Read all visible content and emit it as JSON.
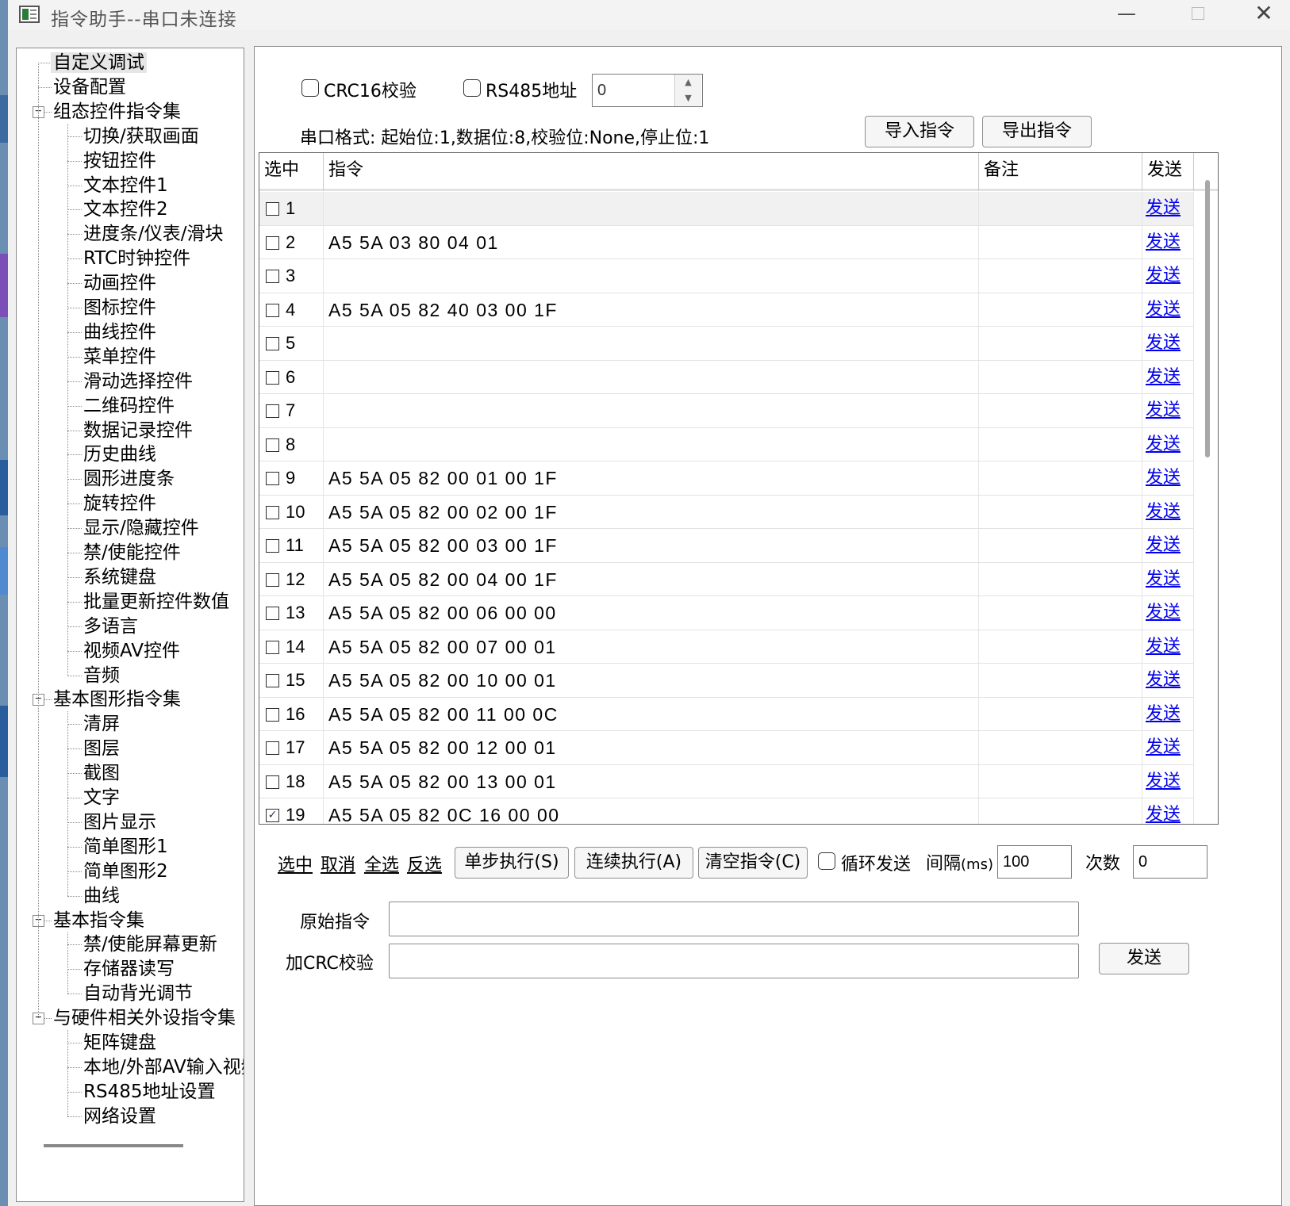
{
  "window": {
    "title": "指令助手--串口未连接",
    "minimize_glyph": "—",
    "close_glyph": "✕"
  },
  "tree": {
    "items": [
      {
        "label": "自定义调试",
        "level": 1,
        "selected": true
      },
      {
        "label": "设备配置",
        "level": 1
      },
      {
        "label": "组态控件指令集",
        "level": 1,
        "expander": "−"
      },
      {
        "label": "切换/获取画面",
        "level": 2
      },
      {
        "label": "按钮控件",
        "level": 2
      },
      {
        "label": "文本控件1",
        "level": 2
      },
      {
        "label": "文本控件2",
        "level": 2
      },
      {
        "label": "进度条/仪表/滑块",
        "level": 2
      },
      {
        "label": "RTC时钟控件",
        "level": 2
      },
      {
        "label": "动画控件",
        "level": 2
      },
      {
        "label": "图标控件",
        "level": 2
      },
      {
        "label": "曲线控件",
        "level": 2
      },
      {
        "label": "菜单控件",
        "level": 2
      },
      {
        "label": "滑动选择控件",
        "level": 2
      },
      {
        "label": "二维码控件",
        "level": 2
      },
      {
        "label": "数据记录控件",
        "level": 2
      },
      {
        "label": "历史曲线",
        "level": 2
      },
      {
        "label": "圆形进度条",
        "level": 2
      },
      {
        "label": "旋转控件",
        "level": 2
      },
      {
        "label": "显示/隐藏控件",
        "level": 2
      },
      {
        "label": "禁/使能控件",
        "level": 2
      },
      {
        "label": "系统键盘",
        "level": 2
      },
      {
        "label": "批量更新控件数值",
        "level": 2
      },
      {
        "label": "多语言",
        "level": 2
      },
      {
        "label": "视频AV控件",
        "level": 2
      },
      {
        "label": "音频",
        "level": 2
      },
      {
        "label": "基本图形指令集",
        "level": 1,
        "expander": "−"
      },
      {
        "label": "清屏",
        "level": 2
      },
      {
        "label": "图层",
        "level": 2
      },
      {
        "label": "截图",
        "level": 2
      },
      {
        "label": "文字",
        "level": 2
      },
      {
        "label": "图片显示",
        "level": 2
      },
      {
        "label": "简单图形1",
        "level": 2
      },
      {
        "label": "简单图形2",
        "level": 2
      },
      {
        "label": "曲线",
        "level": 2
      },
      {
        "label": "基本指令集",
        "level": 1,
        "expander": "−"
      },
      {
        "label": "禁/使能屏幕更新",
        "level": 2
      },
      {
        "label": "存储器读写",
        "level": 2
      },
      {
        "label": "自动背光调节",
        "level": 2
      },
      {
        "label": "与硬件相关外设指令集",
        "level": 1,
        "expander": "−"
      },
      {
        "label": "矩阵键盘",
        "level": 2
      },
      {
        "label": "本地/外部AV输入视频",
        "level": 2
      },
      {
        "label": "RS485地址设置",
        "level": 2
      },
      {
        "label": "网络设置",
        "level": 2
      }
    ]
  },
  "options": {
    "crc_label": "CRC16校验",
    "crc_checked": false,
    "rs485_label": "RS485地址",
    "rs485_checked": false,
    "rs485_value": "0",
    "serial_format": "串口格式:  起始位:1,数据位:8,校验位:None,停止位:1",
    "import_label": "导入指令",
    "export_label": "导出指令"
  },
  "grid": {
    "columns": [
      "选中",
      "指令",
      "备注",
      "发送"
    ],
    "rows": [
      {
        "n": "1",
        "cmd": "",
        "note": "",
        "send": "发送",
        "checked": false
      },
      {
        "n": "2",
        "cmd": "A5 5A 03 80 04 01",
        "note": "",
        "send": "发送",
        "checked": false
      },
      {
        "n": "3",
        "cmd": "",
        "note": "",
        "send": "发送",
        "checked": false
      },
      {
        "n": "4",
        "cmd": "A5 5A 05 82 40 03 00 1F",
        "note": "",
        "send": "发送",
        "checked": false
      },
      {
        "n": "5",
        "cmd": "",
        "note": "",
        "send": "发送",
        "checked": false
      },
      {
        "n": "6",
        "cmd": "",
        "note": "",
        "send": "发送",
        "checked": false
      },
      {
        "n": "7",
        "cmd": "",
        "note": "",
        "send": "发送",
        "checked": false
      },
      {
        "n": "8",
        "cmd": "",
        "note": "",
        "send": "发送",
        "checked": false
      },
      {
        "n": "9",
        "cmd": "A5 5A 05 82 00 01 00 1F",
        "note": "",
        "send": "发送",
        "checked": false
      },
      {
        "n": "10",
        "cmd": "A5 5A 05 82 00 02 00 1F",
        "note": "",
        "send": "发送",
        "checked": false
      },
      {
        "n": "11",
        "cmd": "A5 5A 05 82 00 03 00 1F",
        "note": "",
        "send": "发送",
        "checked": false
      },
      {
        "n": "12",
        "cmd": "A5 5A 05 82 00 04 00 1F",
        "note": "",
        "send": "发送",
        "checked": false
      },
      {
        "n": "13",
        "cmd": "A5 5A 05 82 00 06 00 00",
        "note": "",
        "send": "发送",
        "checked": false
      },
      {
        "n": "14",
        "cmd": "A5 5A 05 82 00 07 00 01",
        "note": "",
        "send": "发送",
        "checked": false
      },
      {
        "n": "15",
        "cmd": "A5 5A 05 82 00 10 00 01",
        "note": "",
        "send": "发送",
        "checked": false
      },
      {
        "n": "16",
        "cmd": "A5 5A 05 82 00 11 00 0C",
        "note": "",
        "send": "发送",
        "checked": false
      },
      {
        "n": "17",
        "cmd": "A5 5A 05 82 00 12 00 01",
        "note": "",
        "send": "发送",
        "checked": false
      },
      {
        "n": "18",
        "cmd": "A5 5A 05 82 00 13 00 01",
        "note": "",
        "send": "发送",
        "checked": false
      },
      {
        "n": "19",
        "cmd": "A5 5A 05 82 0C 16 00 00",
        "note": "",
        "send": "发送",
        "checked": true
      }
    ]
  },
  "controls": {
    "select_label": "选中",
    "cancel_label": "取消",
    "select_all_label": "全选",
    "invert_label": "反选",
    "step_label": "单步执行(S)",
    "continuous_label": "连续执行(A)",
    "clear_label": "清空指令(C)",
    "loop_label": "循环发送",
    "loop_checked": false,
    "interval_label": "间隔",
    "interval_unit": "(ms)",
    "interval_value": "100",
    "count_label": "次数",
    "count_value": "0"
  },
  "send_area": {
    "raw_label": "原始指令",
    "raw_value": "",
    "crc_label": "加CRC校验",
    "crc_value": "",
    "send_label": "发送"
  }
}
